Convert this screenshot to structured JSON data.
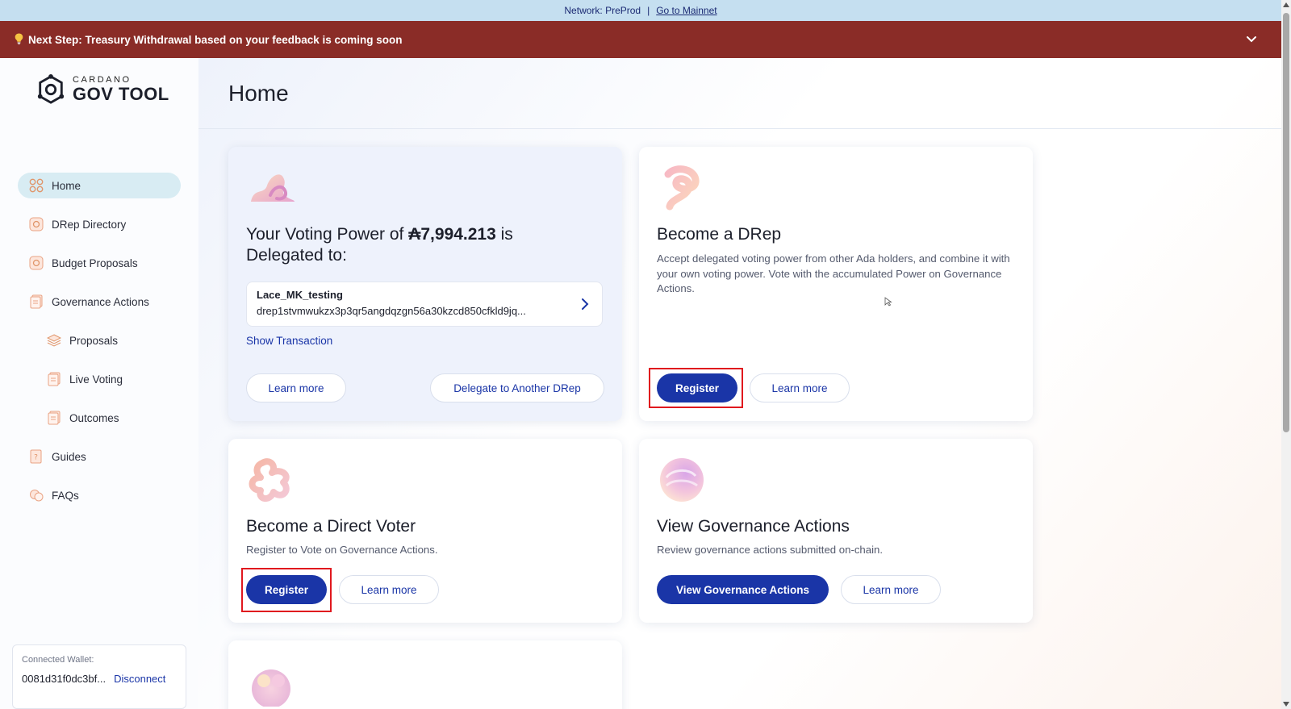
{
  "netbar": {
    "network": "Network: PreProd",
    "separator": "|",
    "mainnet_link": "Go to Mainnet"
  },
  "banner": {
    "text": "Next Step: Treasury Withdrawal based on your feedback is coming soon"
  },
  "logo": {
    "small": "CARDANO",
    "big": "GOV TOOL"
  },
  "sidebar": {
    "items": [
      {
        "label": "Home",
        "icon": "grid-icon",
        "active": true
      },
      {
        "label": "DRep Directory",
        "icon": "drep-icon"
      },
      {
        "label": "Budget Proposals",
        "icon": "budget-icon"
      },
      {
        "label": "Governance Actions",
        "icon": "document-icon"
      },
      {
        "label": "Proposals",
        "icon": "layers-icon"
      },
      {
        "label": "Live Voting",
        "icon": "document-icon"
      },
      {
        "label": "Outcomes",
        "icon": "document-icon"
      },
      {
        "label": "Guides",
        "icon": "guide-icon"
      },
      {
        "label": "FAQs",
        "icon": "chat-icon"
      }
    ]
  },
  "wallet": {
    "label": "Connected Wallet:",
    "address": "0081d31f0dc3bf...",
    "disconnect": "Disconnect"
  },
  "page": {
    "title": "Home"
  },
  "voting_card": {
    "title_prefix": "Your Voting Power of ",
    "amount": "₳7,994.213",
    "title_suffix": " is",
    "title_line2": "Delegated to:",
    "drep_name": "Lace_MK_testing",
    "drep_id": "drep1stvmwukzx3p3qr5angdqzgn56a30kzcd850cfkld9jq...",
    "show_tx": "Show Transaction",
    "learn_more": "Learn more",
    "delegate_other": "Delegate to Another DRep"
  },
  "drep_card": {
    "title": "Become a DRep",
    "desc": "Accept delegated voting power from other Ada holders, and combine it with your own voting power. Vote with the accumulated Power on Governance Actions.",
    "register": "Register",
    "learn_more": "Learn more"
  },
  "voter_card": {
    "title": "Become a Direct Voter",
    "desc": "Register to Vote on Governance Actions.",
    "register": "Register",
    "learn_more": "Learn more"
  },
  "gov_card": {
    "title": "View Governance Actions",
    "desc": "Review governance actions submitted on-chain.",
    "view": "View Governance Actions",
    "learn_more": "Learn more"
  },
  "colors": {
    "primary": "#1a35a7",
    "banner": "#8a2c27",
    "netbar": "#c5dff0",
    "highlight": "#e0181e",
    "active_nav": "#d8ecf3"
  }
}
